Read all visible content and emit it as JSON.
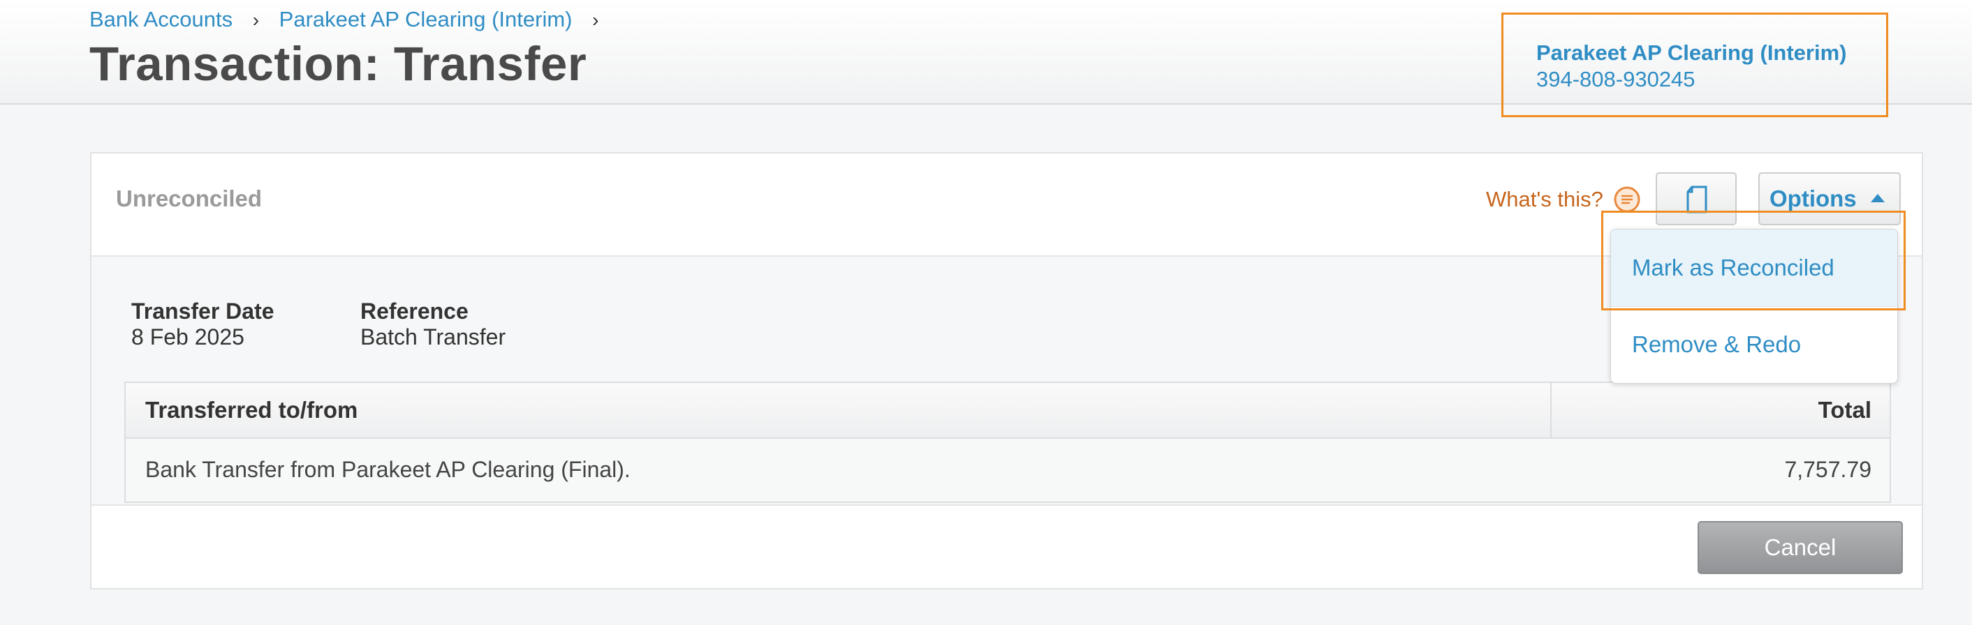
{
  "breadcrumb": {
    "items": [
      "Bank Accounts",
      "Parakeet AP Clearing (Interim)"
    ],
    "separator": "›"
  },
  "page": {
    "title": "Transaction: Transfer"
  },
  "account": {
    "name": "Parakeet AP Clearing (Interim)",
    "number": "394-808-930245"
  },
  "panel": {
    "status": "Unreconciled",
    "whats_this": "What's this?",
    "options_label": "Options",
    "options_menu": [
      "Mark as Reconciled",
      "Remove & Redo"
    ],
    "fields": {
      "transfer_date_label": "Transfer Date",
      "transfer_date_value": "8 Feb 2025",
      "reference_label": "Reference",
      "reference_value": "Batch Transfer"
    },
    "table": {
      "columns": [
        "Transferred to/from",
        "Total"
      ],
      "rows": [
        {
          "description": "Bank Transfer from Parakeet AP Clearing (Final).",
          "total": "7,757.79"
        }
      ]
    },
    "cancel_label": "Cancel"
  },
  "icons": {
    "help": "speech-bubble-icon",
    "document": "document-icon",
    "options_caret": "caret-up-icon"
  },
  "colors": {
    "link": "#2f8dc4",
    "accent_orange": "#c7651c",
    "highlight": "#ef8c22",
    "title": "#4a4a4a"
  }
}
